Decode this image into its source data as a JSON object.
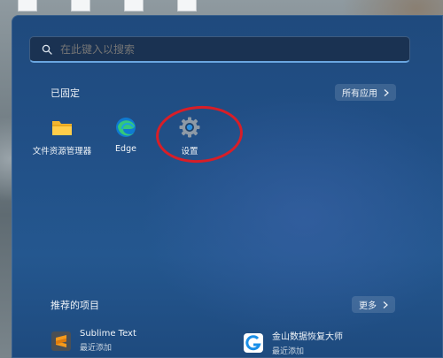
{
  "search": {
    "placeholder": "在此键入以搜索"
  },
  "pinned": {
    "title": "已固定",
    "all_apps_label": "所有应用",
    "apps": [
      {
        "label": "文件资源管理器",
        "icon": "folder-icon"
      },
      {
        "label": "Edge",
        "icon": "edge-icon"
      },
      {
        "label": "设置",
        "icon": "gear-icon"
      }
    ]
  },
  "recommended": {
    "title": "推荐的项目",
    "more_label": "更多",
    "items": [
      {
        "title": "Sublime Text",
        "subtitle": "最近添加",
        "icon": "sublime-text-icon"
      },
      {
        "title": "金山数据恢复大师",
        "subtitle": "最近添加",
        "icon": "data-recovery-icon"
      }
    ]
  },
  "colors": {
    "panel": "#214f86",
    "search_accent": "#6aa6e0",
    "highlight_circle": "#d81e27"
  }
}
